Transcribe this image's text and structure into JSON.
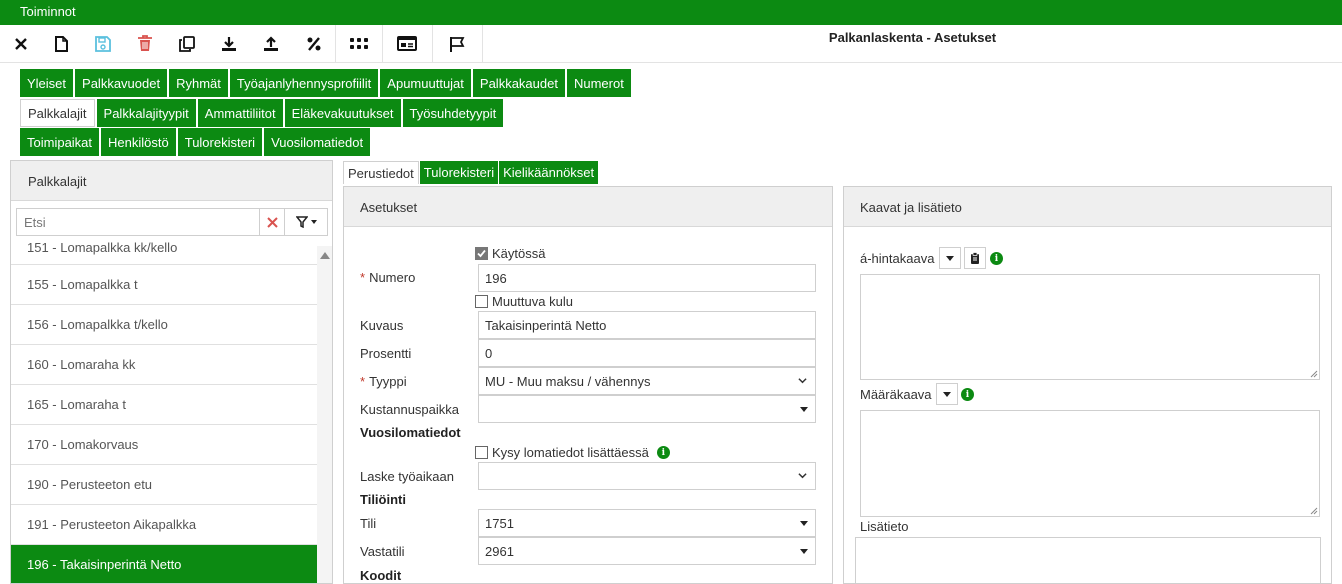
{
  "topbar": {
    "title": "Toiminnot"
  },
  "toolbar": {
    "buttons": [
      "close-icon",
      "new-file-icon",
      "save-icon",
      "delete-icon",
      "copy-icon",
      "download-icon",
      "upload-icon",
      "percent-icon",
      "grid-icon",
      "id-card-icon",
      "flag-icon"
    ],
    "page_title": "Palkanlaskenta - Asetukset"
  },
  "tabs": {
    "row1": [
      "Yleiset",
      "Palkkavuodet",
      "Ryhmät",
      "Työajanlyhennysprofiilit",
      "Apumuuttujat",
      "Palkkakaudet",
      "Numerot"
    ],
    "row2": [
      "Palkkalajit",
      "Palkkalajityypit",
      "Ammattiliitot",
      "Eläkevakuutukset",
      "Työsuhdetyypit"
    ],
    "row3": [
      "Toimipaikat",
      "Henkilöstö",
      "Tulorekisteri",
      "Vuosilomatiedot"
    ],
    "active": "Palkkalajit"
  },
  "left": {
    "title": "Palkkalajit",
    "search_placeholder": "Etsi",
    "items": [
      "151 - Lomapalkka kk/kello",
      "155 - Lomapalkka t",
      "156 - Lomapalkka t/kello",
      "160 - Lomaraha kk",
      "165 - Lomaraha t",
      "170 - Lomakorvaus",
      "190 - Perusteeton etu",
      "191 - Perusteeton Aikapalkka",
      "196 - Takaisinperintä Netto"
    ],
    "selected_index": 8
  },
  "mid_tabs": [
    "Perustiedot",
    "Tulorekisteri",
    "Kielikäännökset"
  ],
  "form": {
    "title": "Asetukset",
    "kaytossa_label": "Käytössä",
    "kaytossa_checked": true,
    "numero_label": "Numero",
    "numero_value": "196",
    "muuttuva_label": "Muuttuva kulu",
    "muuttuva_checked": false,
    "kuvaus_label": "Kuvaus",
    "kuvaus_value": "Takaisinperintä Netto",
    "prosentti_label": "Prosentti",
    "prosentti_value": "0",
    "tyyppi_label": "Tyyppi",
    "tyyppi_value": "MU - Muu maksu / vähennys",
    "kustannuspaikka_label": "Kustannuspaikka",
    "kustannuspaikka_value": "",
    "vuosiloma_section": "Vuosilomatiedot",
    "kysy_label": "Kysy lomatiedot lisättäessä",
    "kysy_checked": false,
    "laske_label": "Laske työaikaan",
    "laske_value": "",
    "tiliointi_section": "Tiliöinti",
    "tili_label": "Tili",
    "tili_value": "1751",
    "vastatili_label": "Vastatili",
    "vastatili_value": "2961",
    "koodit_section": "Koodit"
  },
  "right": {
    "title": "Kaavat ja lisätieto",
    "ahinta_label": "á-hintakaava",
    "maara_label": "Määräkaava",
    "lisatieto_label": "Lisätieto"
  },
  "colors": {
    "brand_green": "#0c8a12",
    "delete_red": "#d9534f",
    "save_blue": "#5bc0de"
  }
}
